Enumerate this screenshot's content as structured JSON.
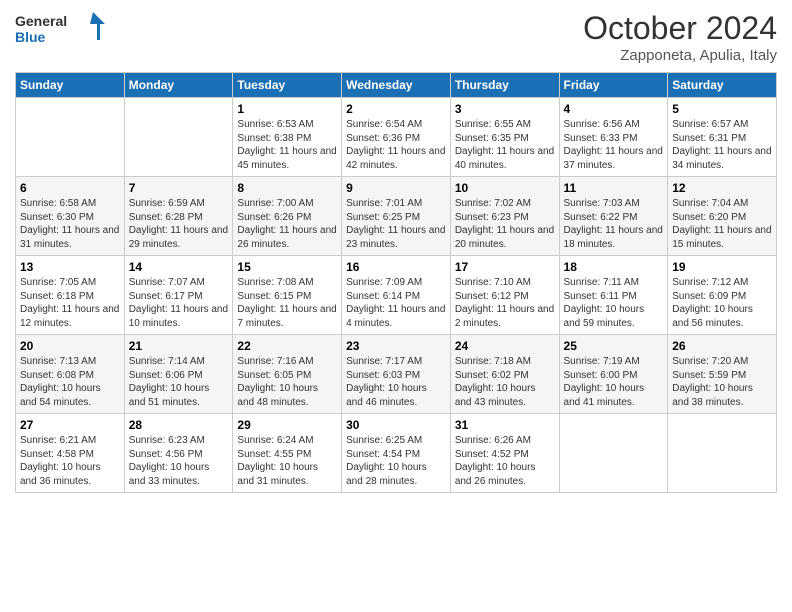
{
  "logo": {
    "general": "General",
    "blue": "Blue"
  },
  "title": "October 2024",
  "location": "Zapponeta, Apulia, Italy",
  "days_of_week": [
    "Sunday",
    "Monday",
    "Tuesday",
    "Wednesday",
    "Thursday",
    "Friday",
    "Saturday"
  ],
  "weeks": [
    [
      {
        "day": "",
        "sunrise": "",
        "sunset": "",
        "daylight": ""
      },
      {
        "day": "",
        "sunrise": "",
        "sunset": "",
        "daylight": ""
      },
      {
        "day": "1",
        "sunrise": "Sunrise: 6:53 AM",
        "sunset": "Sunset: 6:38 PM",
        "daylight": "Daylight: 11 hours and 45 minutes."
      },
      {
        "day": "2",
        "sunrise": "Sunrise: 6:54 AM",
        "sunset": "Sunset: 6:36 PM",
        "daylight": "Daylight: 11 hours and 42 minutes."
      },
      {
        "day": "3",
        "sunrise": "Sunrise: 6:55 AM",
        "sunset": "Sunset: 6:35 PM",
        "daylight": "Daylight: 11 hours and 40 minutes."
      },
      {
        "day": "4",
        "sunrise": "Sunrise: 6:56 AM",
        "sunset": "Sunset: 6:33 PM",
        "daylight": "Daylight: 11 hours and 37 minutes."
      },
      {
        "day": "5",
        "sunrise": "Sunrise: 6:57 AM",
        "sunset": "Sunset: 6:31 PM",
        "daylight": "Daylight: 11 hours and 34 minutes."
      }
    ],
    [
      {
        "day": "6",
        "sunrise": "Sunrise: 6:58 AM",
        "sunset": "Sunset: 6:30 PM",
        "daylight": "Daylight: 11 hours and 31 minutes."
      },
      {
        "day": "7",
        "sunrise": "Sunrise: 6:59 AM",
        "sunset": "Sunset: 6:28 PM",
        "daylight": "Daylight: 11 hours and 29 minutes."
      },
      {
        "day": "8",
        "sunrise": "Sunrise: 7:00 AM",
        "sunset": "Sunset: 6:26 PM",
        "daylight": "Daylight: 11 hours and 26 minutes."
      },
      {
        "day": "9",
        "sunrise": "Sunrise: 7:01 AM",
        "sunset": "Sunset: 6:25 PM",
        "daylight": "Daylight: 11 hours and 23 minutes."
      },
      {
        "day": "10",
        "sunrise": "Sunrise: 7:02 AM",
        "sunset": "Sunset: 6:23 PM",
        "daylight": "Daylight: 11 hours and 20 minutes."
      },
      {
        "day": "11",
        "sunrise": "Sunrise: 7:03 AM",
        "sunset": "Sunset: 6:22 PM",
        "daylight": "Daylight: 11 hours and 18 minutes."
      },
      {
        "day": "12",
        "sunrise": "Sunrise: 7:04 AM",
        "sunset": "Sunset: 6:20 PM",
        "daylight": "Daylight: 11 hours and 15 minutes."
      }
    ],
    [
      {
        "day": "13",
        "sunrise": "Sunrise: 7:05 AM",
        "sunset": "Sunset: 6:18 PM",
        "daylight": "Daylight: 11 hours and 12 minutes."
      },
      {
        "day": "14",
        "sunrise": "Sunrise: 7:07 AM",
        "sunset": "Sunset: 6:17 PM",
        "daylight": "Daylight: 11 hours and 10 minutes."
      },
      {
        "day": "15",
        "sunrise": "Sunrise: 7:08 AM",
        "sunset": "Sunset: 6:15 PM",
        "daylight": "Daylight: 11 hours and 7 minutes."
      },
      {
        "day": "16",
        "sunrise": "Sunrise: 7:09 AM",
        "sunset": "Sunset: 6:14 PM",
        "daylight": "Daylight: 11 hours and 4 minutes."
      },
      {
        "day": "17",
        "sunrise": "Sunrise: 7:10 AM",
        "sunset": "Sunset: 6:12 PM",
        "daylight": "Daylight: 11 hours and 2 minutes."
      },
      {
        "day": "18",
        "sunrise": "Sunrise: 7:11 AM",
        "sunset": "Sunset: 6:11 PM",
        "daylight": "Daylight: 10 hours and 59 minutes."
      },
      {
        "day": "19",
        "sunrise": "Sunrise: 7:12 AM",
        "sunset": "Sunset: 6:09 PM",
        "daylight": "Daylight: 10 hours and 56 minutes."
      }
    ],
    [
      {
        "day": "20",
        "sunrise": "Sunrise: 7:13 AM",
        "sunset": "Sunset: 6:08 PM",
        "daylight": "Daylight: 10 hours and 54 minutes."
      },
      {
        "day": "21",
        "sunrise": "Sunrise: 7:14 AM",
        "sunset": "Sunset: 6:06 PM",
        "daylight": "Daylight: 10 hours and 51 minutes."
      },
      {
        "day": "22",
        "sunrise": "Sunrise: 7:16 AM",
        "sunset": "Sunset: 6:05 PM",
        "daylight": "Daylight: 10 hours and 48 minutes."
      },
      {
        "day": "23",
        "sunrise": "Sunrise: 7:17 AM",
        "sunset": "Sunset: 6:03 PM",
        "daylight": "Daylight: 10 hours and 46 minutes."
      },
      {
        "day": "24",
        "sunrise": "Sunrise: 7:18 AM",
        "sunset": "Sunset: 6:02 PM",
        "daylight": "Daylight: 10 hours and 43 minutes."
      },
      {
        "day": "25",
        "sunrise": "Sunrise: 7:19 AM",
        "sunset": "Sunset: 6:00 PM",
        "daylight": "Daylight: 10 hours and 41 minutes."
      },
      {
        "day": "26",
        "sunrise": "Sunrise: 7:20 AM",
        "sunset": "Sunset: 5:59 PM",
        "daylight": "Daylight: 10 hours and 38 minutes."
      }
    ],
    [
      {
        "day": "27",
        "sunrise": "Sunrise: 6:21 AM",
        "sunset": "Sunset: 4:58 PM",
        "daylight": "Daylight: 10 hours and 36 minutes."
      },
      {
        "day": "28",
        "sunrise": "Sunrise: 6:23 AM",
        "sunset": "Sunset: 4:56 PM",
        "daylight": "Daylight: 10 hours and 33 minutes."
      },
      {
        "day": "29",
        "sunrise": "Sunrise: 6:24 AM",
        "sunset": "Sunset: 4:55 PM",
        "daylight": "Daylight: 10 hours and 31 minutes."
      },
      {
        "day": "30",
        "sunrise": "Sunrise: 6:25 AM",
        "sunset": "Sunset: 4:54 PM",
        "daylight": "Daylight: 10 hours and 28 minutes."
      },
      {
        "day": "31",
        "sunrise": "Sunrise: 6:26 AM",
        "sunset": "Sunset: 4:52 PM",
        "daylight": "Daylight: 10 hours and 26 minutes."
      },
      {
        "day": "",
        "sunrise": "",
        "sunset": "",
        "daylight": ""
      },
      {
        "day": "",
        "sunrise": "",
        "sunset": "",
        "daylight": ""
      }
    ]
  ]
}
